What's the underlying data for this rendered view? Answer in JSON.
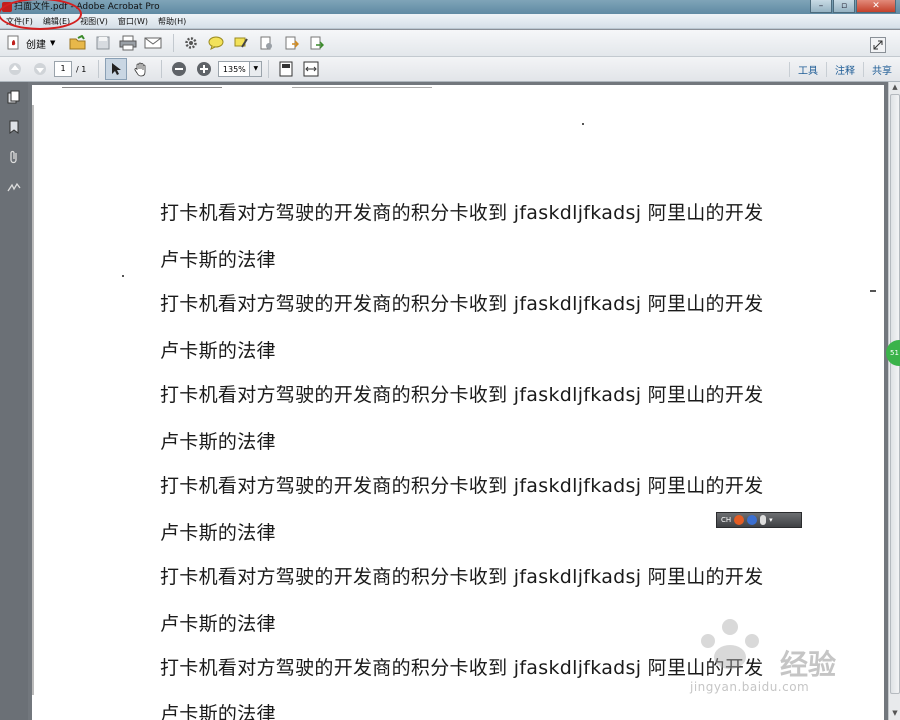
{
  "window": {
    "title": "扫面文件.pdf - Adobe Acrobat Pro",
    "minimize": "–",
    "maximize": "▫",
    "close": "✕"
  },
  "menu": {
    "items": [
      "文件(F)",
      "编辑(E)",
      "视图(V)",
      "窗口(W)",
      "帮助(H)"
    ]
  },
  "toolbar": {
    "create_label": "创建"
  },
  "nav": {
    "page_value": "1",
    "page_total": "/ 1",
    "zoom_value": "135%"
  },
  "right_tabs": {
    "tools": "工具",
    "comment": "注释",
    "share": "共享"
  },
  "document": {
    "lines": [
      "打卡机看对方驾驶的开发商的积分卡收到 jfaskdljfkadsj 阿里山的开发",
      "卢卡斯的法律",
      "打卡机看对方驾驶的开发商的积分卡收到 jfaskdljfkadsj 阿里山的开发",
      "卢卡斯的法律",
      "打卡机看对方驾驶的开发商的积分卡收到 jfaskdljfkadsj 阿里山的开发",
      "卢卡斯的法律",
      "打卡机看对方驾驶的开发商的积分卡收到 jfaskdljfkadsj 阿里山的开发",
      "卢卡斯的法律",
      "打卡机看对方驾驶的开发商的积分卡收到 jfaskdljfkadsj 阿里山的开发",
      "卢卡斯的法律",
      "打卡机看对方驾驶的开发商的积分卡收到 jfaskdljfkadsj 阿里山的开发",
      "卢卡斯的法律"
    ]
  },
  "ime": {
    "label": "CH"
  },
  "watermark": {
    "main": "经验",
    "sub": "jingyan.baidu.com"
  },
  "badge": {
    "label": "51"
  },
  "colors": {
    "annotation_circle": "#d42020",
    "acrobat_red": "#c0201c",
    "link_blue": "#1f5d96"
  }
}
